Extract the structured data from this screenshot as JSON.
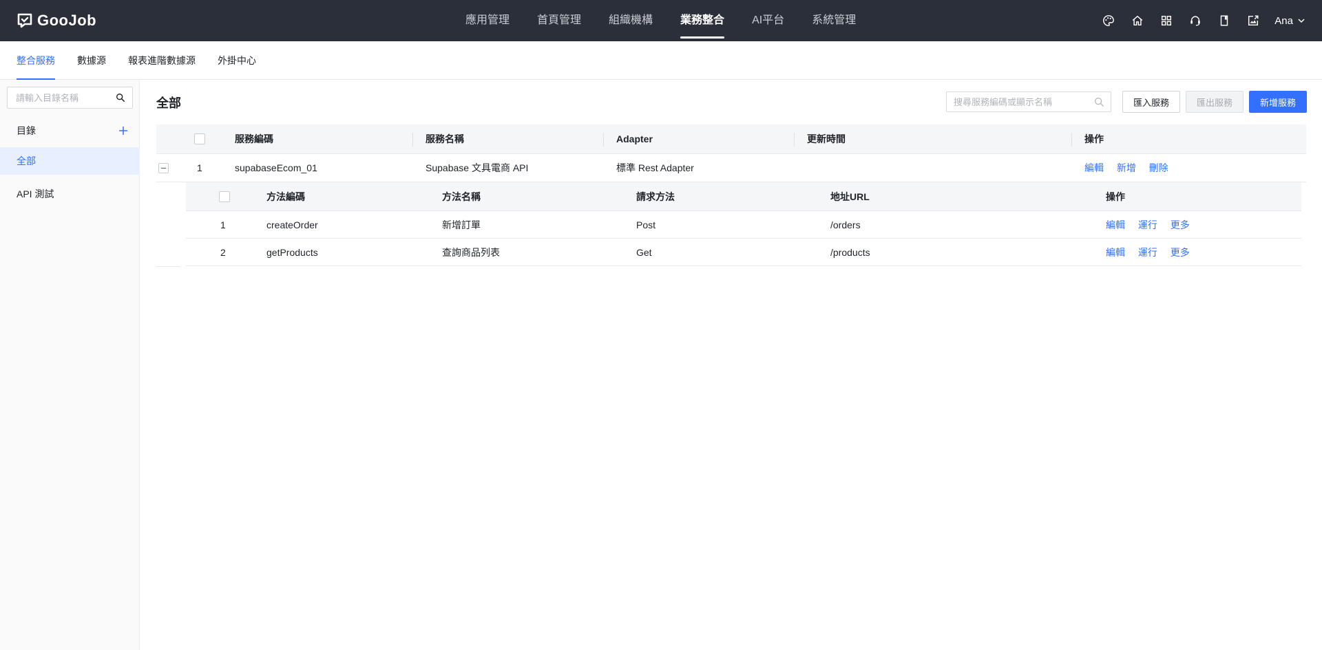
{
  "app": {
    "logo_text": "GooJob",
    "nav": [
      {
        "label": "應用管理",
        "active": false
      },
      {
        "label": "首頁管理",
        "active": false
      },
      {
        "label": "組織機構",
        "active": false
      },
      {
        "label": "業務整合",
        "active": true
      },
      {
        "label": "AI平台",
        "active": false
      },
      {
        "label": "系統管理",
        "active": false
      }
    ],
    "header_icons": [
      "palette-icon",
      "home-icon",
      "apps-grid-icon",
      "support-headset-icon",
      "book-icon",
      "export-image-icon"
    ],
    "user_name": "Ana"
  },
  "subtabs": [
    {
      "label": "整合服務",
      "active": true
    },
    {
      "label": "數據源",
      "active": false
    },
    {
      "label": "報表進階數據源",
      "active": false
    },
    {
      "label": "外掛中心",
      "active": false
    }
  ],
  "sidebar": {
    "search_placeholder": "請輸入目錄名稱",
    "directory_label": "目錄",
    "items": [
      {
        "label": "全部",
        "active": true
      },
      {
        "label": "API 測試",
        "active": false
      }
    ]
  },
  "main": {
    "title": "全部",
    "search_placeholder": "搜尋服務編碼或顯示名稱",
    "buttons": {
      "import": "匯入服務",
      "export": "匯出服務",
      "add": "新增服務"
    },
    "columns": {
      "code": "服務編碼",
      "name": "服務名稱",
      "adapter": "Adapter",
      "updated": "更新時間",
      "actions": "操作"
    },
    "rows": [
      {
        "index": "1",
        "code": "supabaseEcom_01",
        "name": "Supabase 文具電商 API",
        "adapter": "標準 Rest Adapter",
        "updated": "",
        "actions": [
          "編輯",
          "新增",
          "刪除"
        ],
        "expanded": true,
        "sub_columns": {
          "code": "方法編碼",
          "name": "方法名稱",
          "method": "請求方法",
          "url": "地址URL",
          "actions": "操作"
        },
        "sub_rows": [
          {
            "index": "1",
            "code": "createOrder",
            "name": "新增訂單",
            "method": "Post",
            "url": "/orders",
            "actions": [
              "編輯",
              "運行",
              "更多"
            ]
          },
          {
            "index": "2",
            "code": "getProducts",
            "name": "查詢商品列表",
            "method": "Get",
            "url": "/products",
            "actions": [
              "編輯",
              "運行",
              "更多"
            ]
          }
        ]
      }
    ]
  },
  "colors": {
    "header_bg": "#2b2f3a",
    "accent": "#3370ff",
    "sidebar_active_bg": "#e8f0ff"
  }
}
